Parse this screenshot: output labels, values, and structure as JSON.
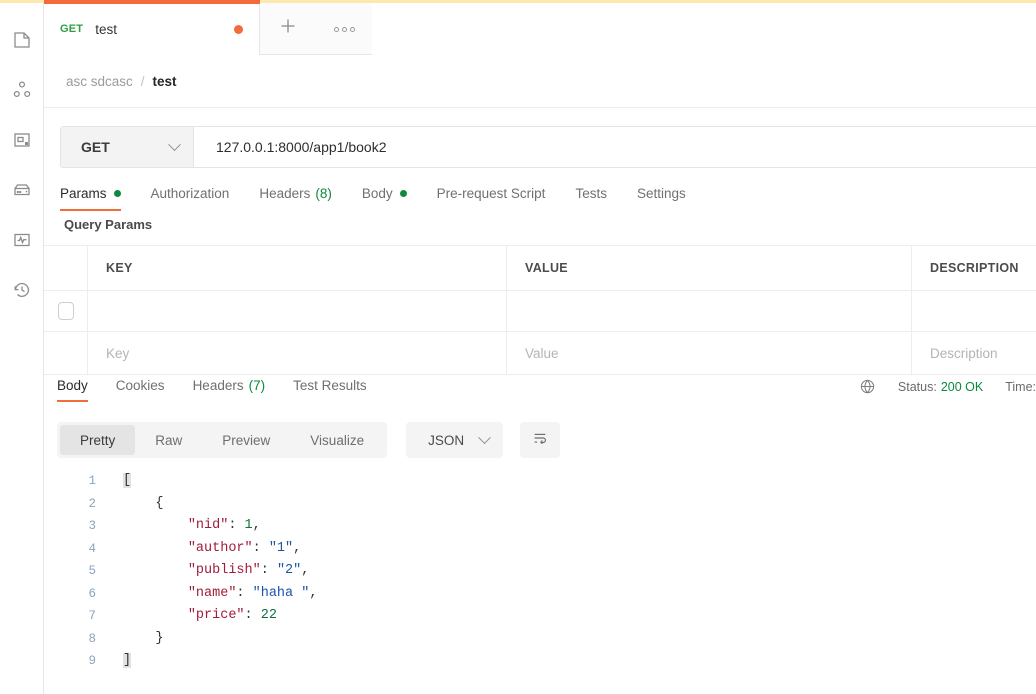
{
  "window": {
    "accent_orange": "#f26b3a",
    "accent_yellow": "#fde9b0",
    "green": "#0d8a3e"
  },
  "sidebar": {
    "items": [
      {
        "name": "collections",
        "icon": "collections-icon"
      },
      {
        "name": "apis",
        "icon": "apis-icon"
      },
      {
        "name": "environments",
        "icon": "environments-icon"
      },
      {
        "name": "mock-servers",
        "icon": "mock-servers-icon"
      },
      {
        "name": "monitors",
        "icon": "monitors-icon"
      },
      {
        "name": "history",
        "icon": "history-icon"
      }
    ]
  },
  "tabbar": {
    "tabs": [
      {
        "method": "GET",
        "title": "test",
        "unsaved": true
      }
    ],
    "new_tab_label": "+",
    "more_label": "ooo"
  },
  "breadcrumb": {
    "parent": "asc sdcasc",
    "separator": "/",
    "current": "test"
  },
  "request": {
    "method": "GET",
    "url": "127.0.0.1:8000/app1/book2",
    "tabs": [
      {
        "label": "Params",
        "dot": true,
        "active": true
      },
      {
        "label": "Authorization",
        "dot": false,
        "active": false
      },
      {
        "label": "Headers",
        "count": "(8)",
        "active": false
      },
      {
        "label": "Body",
        "dot": true,
        "active": false
      },
      {
        "label": "Pre-request Script",
        "active": false
      },
      {
        "label": "Tests",
        "active": false
      },
      {
        "label": "Settings",
        "active": false
      }
    ]
  },
  "query_params": {
    "title": "Query Params",
    "columns": [
      "KEY",
      "VALUE",
      "DESCRIPTION"
    ],
    "placeholder_row": {
      "key": "Key",
      "value": "Value",
      "description": "Description"
    }
  },
  "response": {
    "tabs": [
      {
        "label": "Body",
        "active": true
      },
      {
        "label": "Cookies",
        "active": false
      },
      {
        "label": "Headers",
        "count": "(7)",
        "active": false
      },
      {
        "label": "Test Results",
        "active": false
      }
    ],
    "status_label": "Status:",
    "status_value": "200 OK",
    "time_label": "Time:",
    "globe_icon": "globe-icon",
    "viewer": {
      "modes": [
        "Pretty",
        "Raw",
        "Preview",
        "Visualize"
      ],
      "active_mode": "Pretty",
      "format": "JSON",
      "wrap_icon": "word-wrap-icon"
    },
    "body_lines": [
      {
        "n": "1",
        "tokens": [
          {
            "t": "[",
            "c": "k-brk"
          }
        ]
      },
      {
        "n": "2",
        "tokens": [
          {
            "t": "    {",
            "c": "k-pun"
          }
        ]
      },
      {
        "n": "3",
        "tokens": [
          {
            "t": "        ",
            "c": "k-pun"
          },
          {
            "t": "\"nid\"",
            "c": "k-key"
          },
          {
            "t": ": ",
            "c": "k-pun"
          },
          {
            "t": "1",
            "c": "k-num"
          },
          {
            "t": ",",
            "c": "k-pun"
          }
        ]
      },
      {
        "n": "4",
        "tokens": [
          {
            "t": "        ",
            "c": "k-pun"
          },
          {
            "t": "\"author\"",
            "c": "k-key"
          },
          {
            "t": ": ",
            "c": "k-pun"
          },
          {
            "t": "\"1\"",
            "c": "k-str"
          },
          {
            "t": ",",
            "c": "k-pun"
          }
        ]
      },
      {
        "n": "5",
        "tokens": [
          {
            "t": "        ",
            "c": "k-pun"
          },
          {
            "t": "\"publish\"",
            "c": "k-key"
          },
          {
            "t": ": ",
            "c": "k-pun"
          },
          {
            "t": "\"2\"",
            "c": "k-str"
          },
          {
            "t": ",",
            "c": "k-pun"
          }
        ]
      },
      {
        "n": "6",
        "tokens": [
          {
            "t": "        ",
            "c": "k-pun"
          },
          {
            "t": "\"name\"",
            "c": "k-key"
          },
          {
            "t": ": ",
            "c": "k-pun"
          },
          {
            "t": "\"haha \"",
            "c": "k-str"
          },
          {
            "t": ",",
            "c": "k-pun"
          }
        ]
      },
      {
        "n": "7",
        "tokens": [
          {
            "t": "        ",
            "c": "k-pun"
          },
          {
            "t": "\"price\"",
            "c": "k-key"
          },
          {
            "t": ": ",
            "c": "k-pun"
          },
          {
            "t": "22",
            "c": "k-num"
          }
        ]
      },
      {
        "n": "8",
        "tokens": [
          {
            "t": "    }",
            "c": "k-pun"
          }
        ]
      },
      {
        "n": "9",
        "tokens": [
          {
            "t": "]",
            "c": "k-brk"
          }
        ]
      }
    ]
  }
}
